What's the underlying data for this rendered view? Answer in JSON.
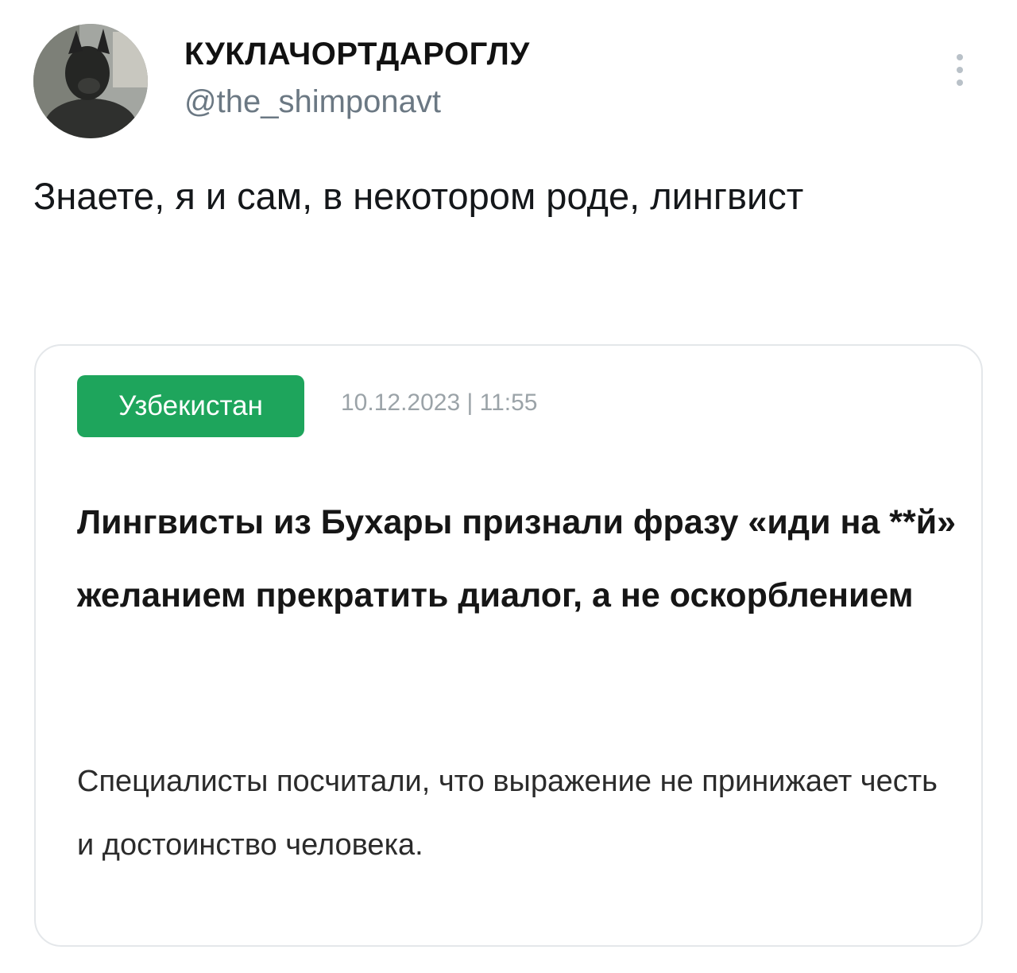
{
  "author": {
    "display_name": "КУКЛАЧОРТДАРОГЛУ",
    "handle": "@the_shimponavt",
    "avatar_icon": "avatar-photo"
  },
  "more_icon": "vertical-ellipsis-icon",
  "tweet": {
    "text": "Знаете, я и сам, в некотором роде, лингвист"
  },
  "embedded_article": {
    "tag": "Узбекистан",
    "date": "10.12.2023 | 11:55",
    "headline": "Лингвисты из Бухары признали фразу «иди на **й» желанием прекратить диалог, а не оскорблением",
    "lead": "Специалисты посчитали, что выражение не принижает честь и достоинство человека.",
    "accent_color": "#1ea55c"
  }
}
